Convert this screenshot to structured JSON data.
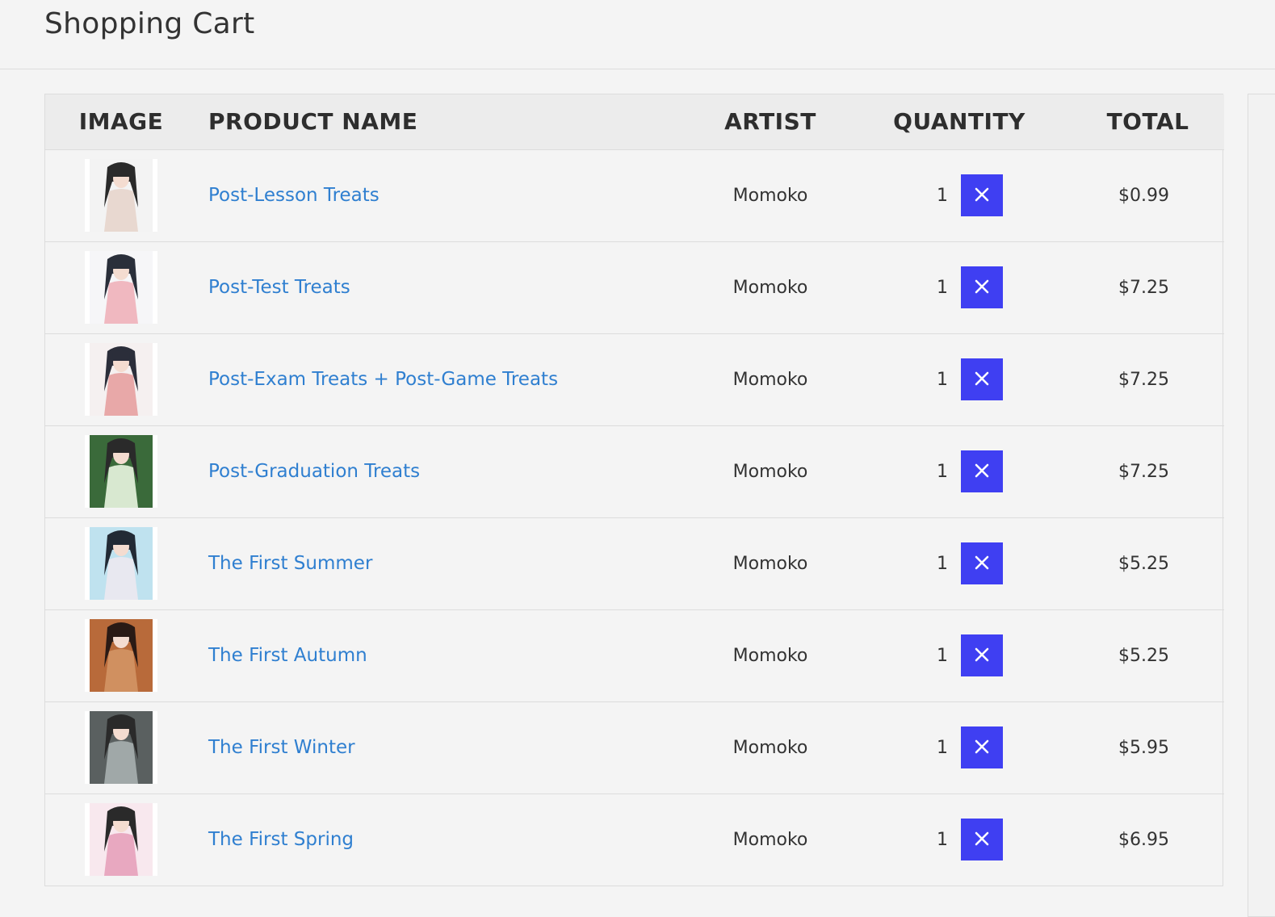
{
  "page": {
    "title": "Shopping Cart"
  },
  "table": {
    "headers": {
      "image": "IMAGE",
      "product_name": "PRODUCT NAME",
      "artist": "ARTIST",
      "quantity": "QUANTITY",
      "total": "TOTAL"
    },
    "rows": [
      {
        "name": "Post-Lesson Treats",
        "artist": "Momoko",
        "quantity": "1",
        "total": "$0.99"
      },
      {
        "name": "Post-Test Treats",
        "artist": "Momoko",
        "quantity": "1",
        "total": "$7.25"
      },
      {
        "name": "Post-Exam Treats + Post-Game Treats",
        "artist": "Momoko",
        "quantity": "1",
        "total": "$7.25"
      },
      {
        "name": "Post-Graduation Treats",
        "artist": "Momoko",
        "quantity": "1",
        "total": "$7.25"
      },
      {
        "name": "The First Summer",
        "artist": "Momoko",
        "quantity": "1",
        "total": "$5.25"
      },
      {
        "name": "The First Autumn",
        "artist": "Momoko",
        "quantity": "1",
        "total": "$5.25"
      },
      {
        "name": "The First Winter",
        "artist": "Momoko",
        "quantity": "1",
        "total": "$5.95"
      },
      {
        "name": "The First Spring",
        "artist": "Momoko",
        "quantity": "1",
        "total": "$6.95"
      }
    ]
  },
  "colors": {
    "link": "#2f7fd0",
    "remove_button": "#3f3ff2",
    "background": "#f4f4f4"
  },
  "icons": {
    "remove": "close-icon"
  }
}
